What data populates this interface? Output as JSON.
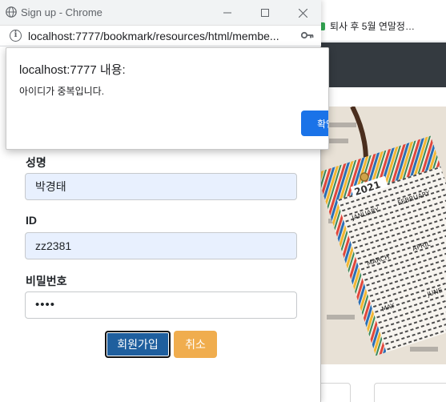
{
  "background": {
    "bookmark_label": "퇴사 후 5월 연말정…",
    "navbar_color": "#343a40"
  },
  "window": {
    "title": "Sign up - Chrome",
    "url": "localhost:7777/bookmark/resources/html/membe..."
  },
  "dialog": {
    "title": "localhost:7777 내용:",
    "message": "아이디가 중복입니다.",
    "ok_label": "확인"
  },
  "form": {
    "name_label": "성명",
    "name_value": "박경태",
    "id_label": "ID",
    "id_value": "zz2381",
    "password_label": "비밀번호",
    "password_value": "••••",
    "signup_button": "회원가입",
    "cancel_button": "취소"
  },
  "colors": {
    "primary_button": "#1f5f9e",
    "warning_button": "#f0ad4e",
    "autofill_bg": "#e8f0fe",
    "dialog_button": "#1a73e8"
  }
}
